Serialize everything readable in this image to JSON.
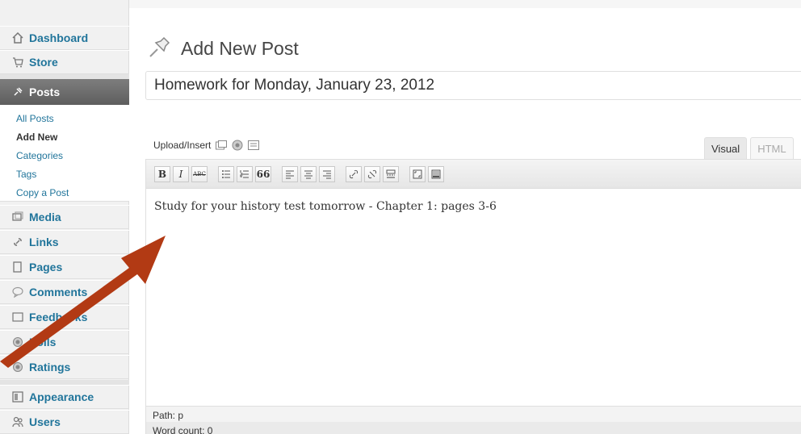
{
  "sidebar": {
    "items": [
      {
        "label": "Dashboard",
        "icon": "dashboard-icon"
      },
      {
        "label": "Store",
        "icon": "store-icon"
      },
      {
        "label": "Posts",
        "icon": "pin-icon"
      },
      {
        "label": "Media",
        "icon": "media-icon"
      },
      {
        "label": "Links",
        "icon": "links-icon"
      },
      {
        "label": "Pages",
        "icon": "pages-icon"
      },
      {
        "label": "Comments",
        "icon": "comments-icon"
      },
      {
        "label": "Feedbacks",
        "icon": "feedbacks-icon"
      },
      {
        "label": "Polls",
        "icon": "polls-icon"
      },
      {
        "label": "Ratings",
        "icon": "ratings-icon"
      },
      {
        "label": "Appearance",
        "icon": "appearance-icon"
      },
      {
        "label": "Users",
        "icon": "users-icon"
      }
    ],
    "posts_submenu": [
      "All Posts",
      "Add New",
      "Categories",
      "Tags",
      "Copy a Post"
    ],
    "current_submenu": "Add New"
  },
  "page": {
    "title": "Add New Post",
    "post_title_value": "Homework for Monday, January 23, 2012"
  },
  "editor": {
    "upload_label": "Upload/Insert",
    "tabs": [
      "Visual",
      "HTML"
    ],
    "active_tab": "Visual",
    "toolbar_buttons": [
      "B",
      "I",
      "ABC",
      "bullet-list",
      "numbered-list",
      "66",
      "align-left",
      "align-center",
      "align-right",
      "link",
      "unlink",
      "more",
      "fullscreen",
      "kitchen-sink"
    ],
    "content": "Study for your history test tomorrow - Chapter 1: pages 3-6",
    "path_label": "Path:",
    "path_value": "p",
    "word_count_label": "Word count: 0"
  },
  "colors": {
    "link": "#21759b",
    "active_menu": "#6d6d6d",
    "arrow": "#b23a14"
  }
}
